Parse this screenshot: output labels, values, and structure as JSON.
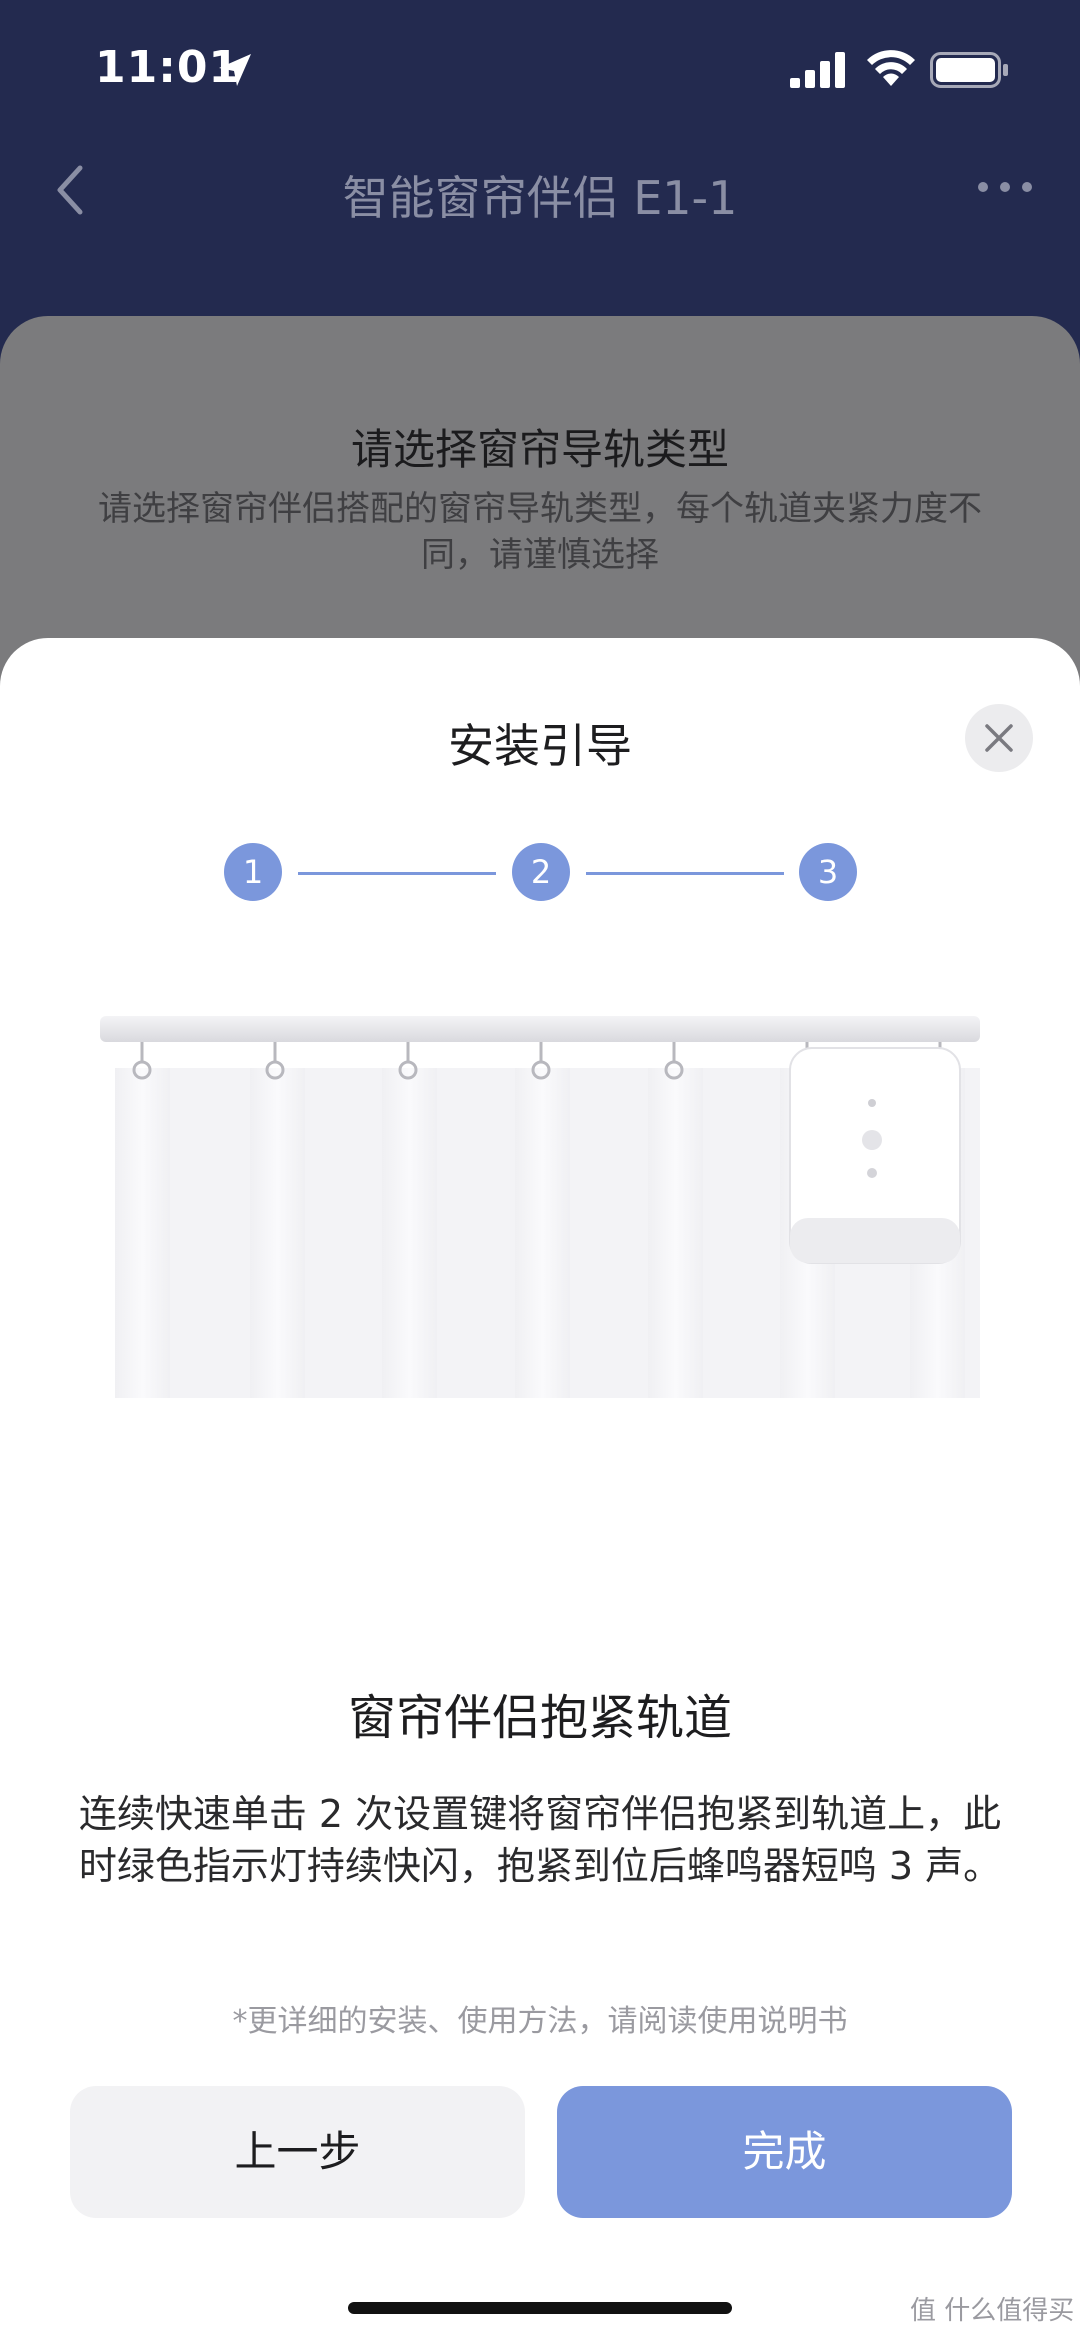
{
  "status_bar": {
    "time": "11:01"
  },
  "nav": {
    "title": "智能窗帘伴侣 E1-1"
  },
  "background_sheet": {
    "title": "请选择窗帘导轨类型",
    "subtitle": "请选择窗帘伴侣搭配的窗帘导轨类型，每个轨道夹紧力度不同，请谨慎选择"
  },
  "modal": {
    "title": "安装引导",
    "steps": [
      "1",
      "2",
      "3"
    ],
    "current_step": 3,
    "step_title": "窗帘伴侣抱紧轨道",
    "step_description": "连续快速单击 2 次设置键将窗帘伴侣抱紧到轨道上，此时绿色指示灯持续快闪，抱紧到位后蜂鸣器短鸣 3 声。",
    "manual_note": "*更详细的安装、使用方法，请阅读使用说明书",
    "prev_button": "上一步",
    "done_button": "完成"
  },
  "watermark": "值 什么值得买",
  "colors": {
    "accent": "#7b97dc",
    "header_bg": "#232a4f",
    "overlay_sheet": "#7b7b7d"
  },
  "icons": {
    "location": "location-arrow-icon",
    "signal": "signal-icon",
    "wifi": "wifi-icon",
    "battery": "battery-icon",
    "back": "chevron-left-icon",
    "more": "more-dots-icon",
    "close": "close-icon"
  }
}
